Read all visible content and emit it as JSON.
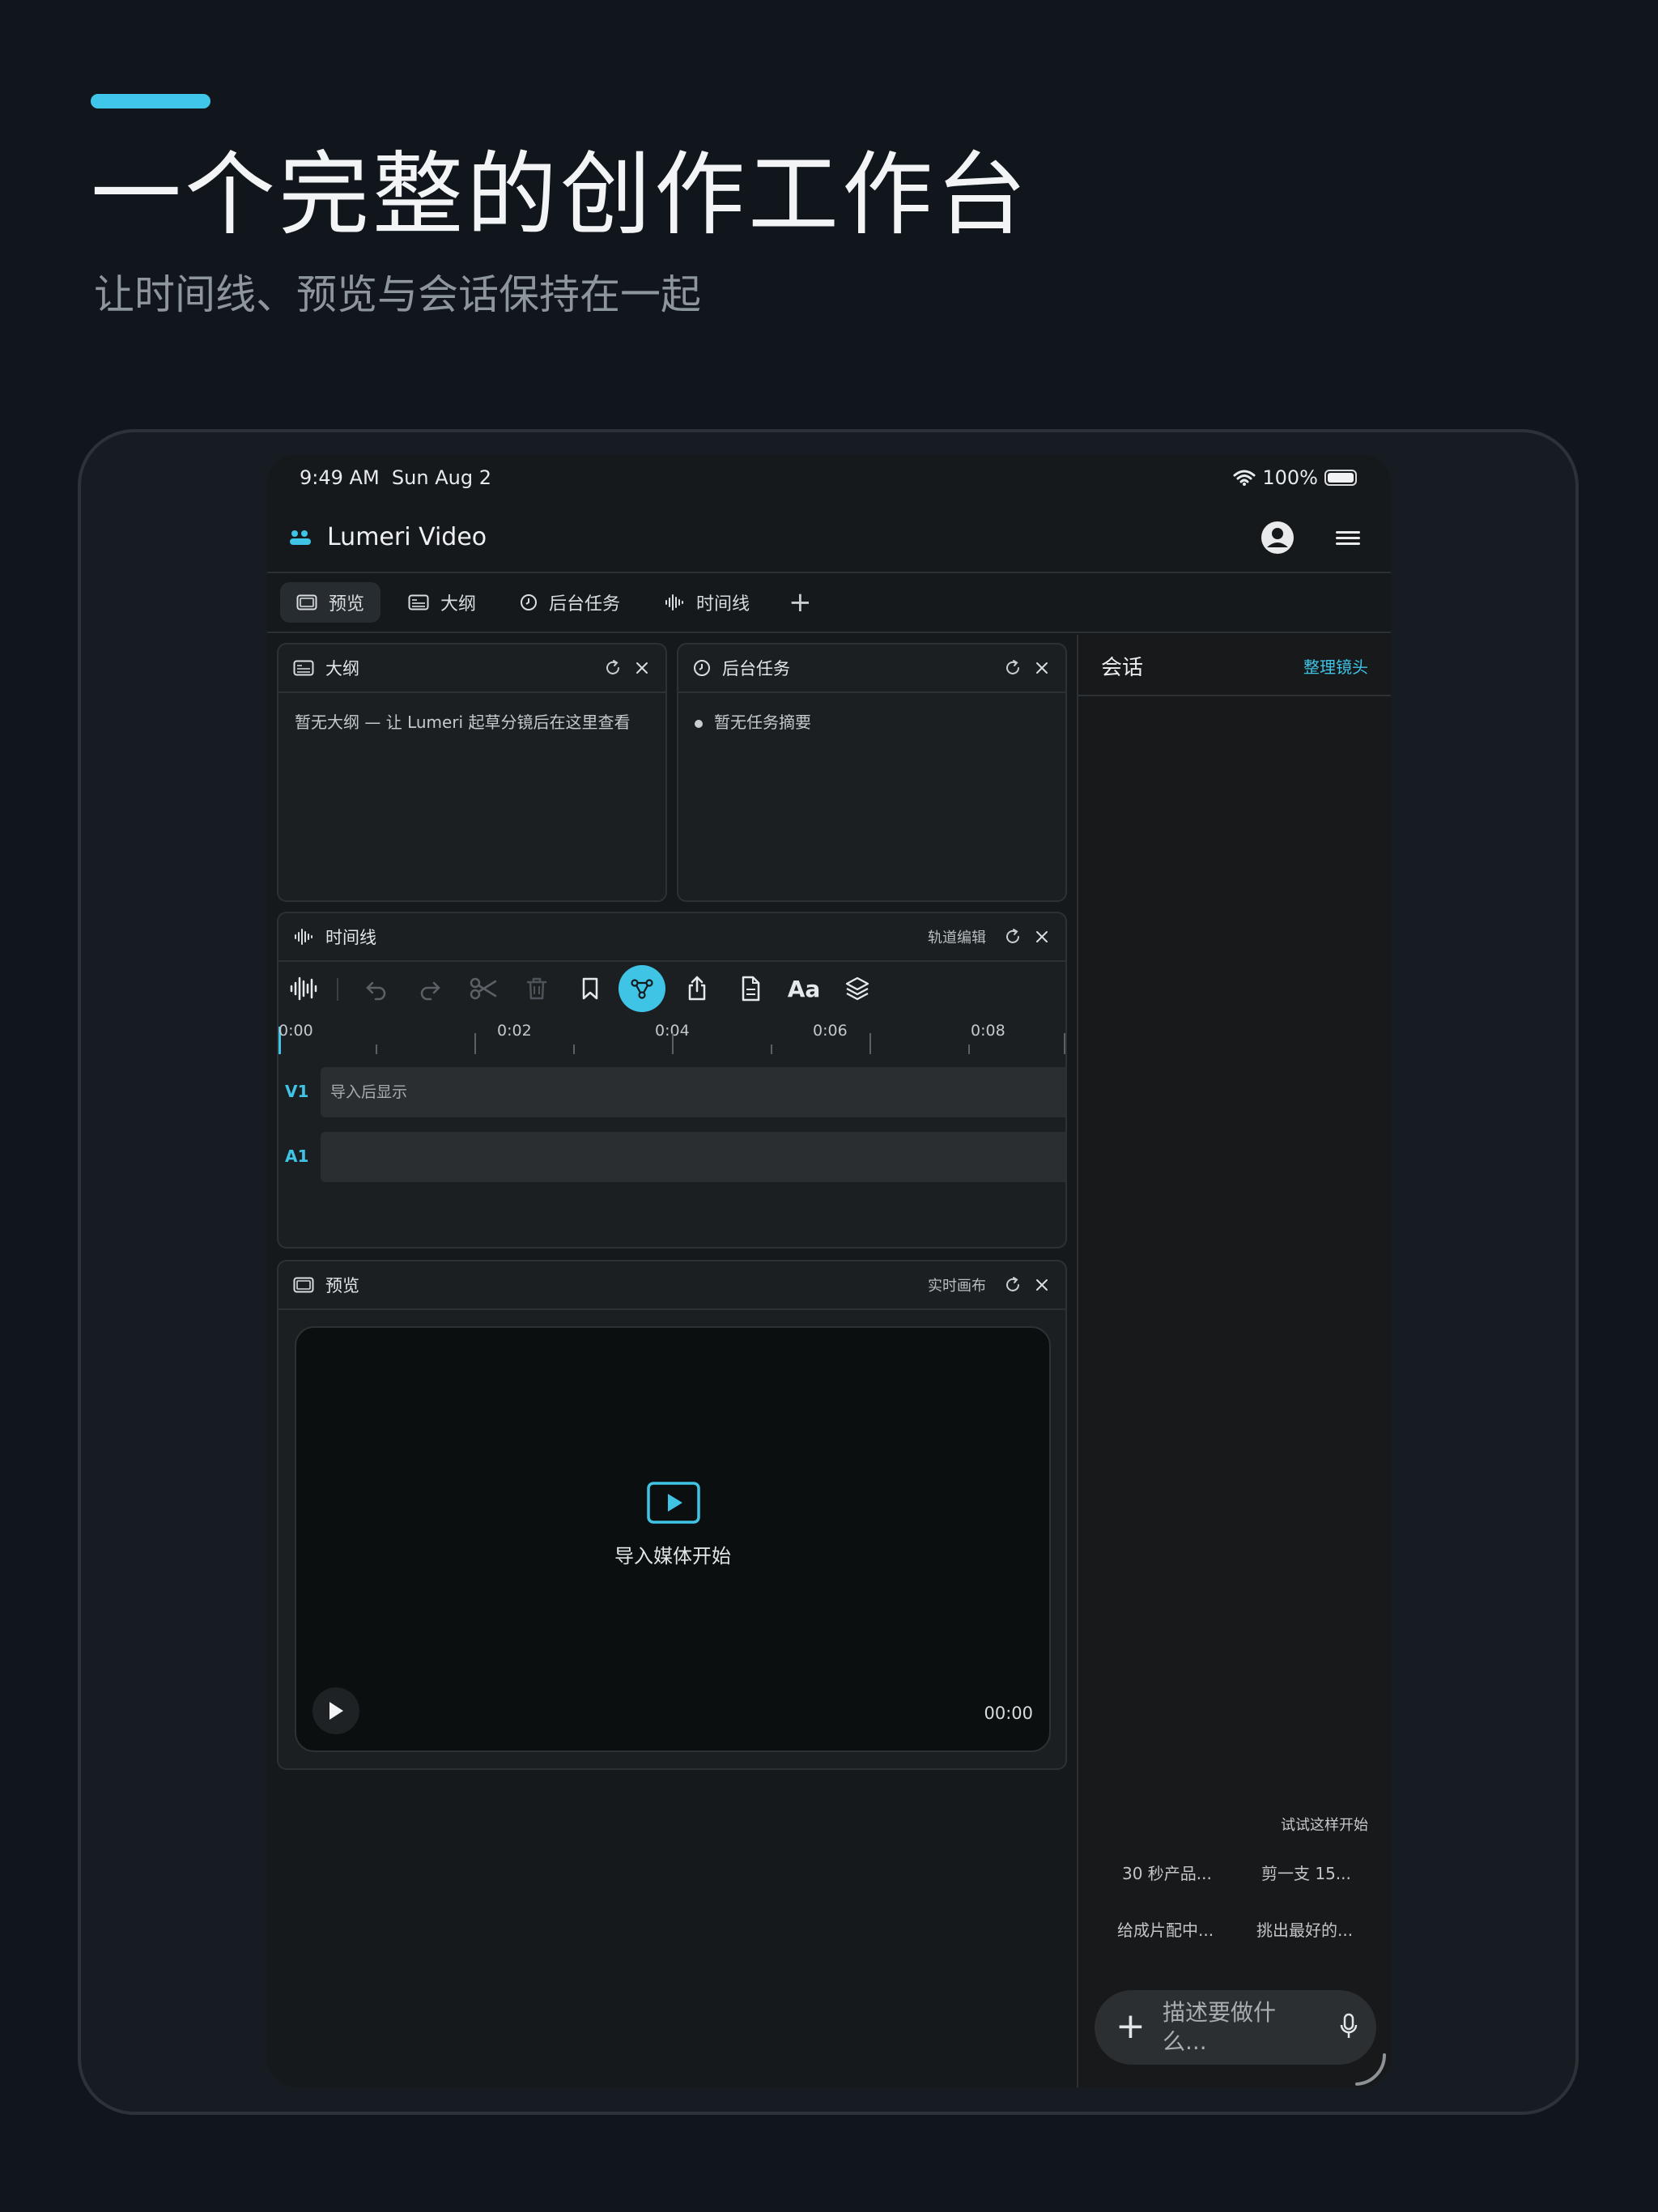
{
  "hero": {
    "title": "一个完整的创作工作台",
    "subtitle": "让时间线、预览与会话保持在一起"
  },
  "status": {
    "time": "9:49 AM",
    "date": "Sun Aug 2",
    "battery": "100%"
  },
  "app": {
    "title": "Lumeri Video"
  },
  "tabs": [
    {
      "label": "预览",
      "icon": "preview-icon",
      "active": true
    },
    {
      "label": "大纲",
      "icon": "outline-icon",
      "active": false
    },
    {
      "label": "后台任务",
      "icon": "clock-icon",
      "active": false
    },
    {
      "label": "时间线",
      "icon": "waveform-icon",
      "active": false
    }
  ],
  "panels": {
    "outline": {
      "title": "大纲",
      "empty": "暂无大纲 — 让 Lumeri 起草分镜后在这里查看"
    },
    "tasks": {
      "title": "后台任务",
      "empty": "暂无任务摘要"
    },
    "timeline": {
      "title": "时间线",
      "meta": "轨道编辑",
      "ruler": [
        "0:00",
        "0:02",
        "0:04",
        "0:06",
        "0:08"
      ],
      "tracks": [
        {
          "label": "V1",
          "placeholder": "导入后显示"
        },
        {
          "label": "A1",
          "placeholder": ""
        }
      ],
      "tools": [
        "waveform-icon",
        "undo-icon",
        "redo-icon",
        "scissors-icon",
        "trash-icon",
        "bookmark-icon",
        "nodes-icon",
        "share-icon",
        "document-icon",
        "Aa",
        "layers-icon"
      ]
    },
    "preview": {
      "title": "预览",
      "meta": "实时画布",
      "empty": "导入媒体开始",
      "timecode": "00:00"
    }
  },
  "chat": {
    "title": "会话",
    "action": "整理镜头",
    "try_label": "试试这样开始",
    "suggestions": [
      "30 秒产品...",
      "剪一支 15...",
      "给成片配中...",
      "挑出最好的..."
    ],
    "placeholder": "描述要做什么..."
  },
  "colors": {
    "accent": "#3fc4e6",
    "background": "#10161b",
    "panel": "#1b1f22"
  }
}
